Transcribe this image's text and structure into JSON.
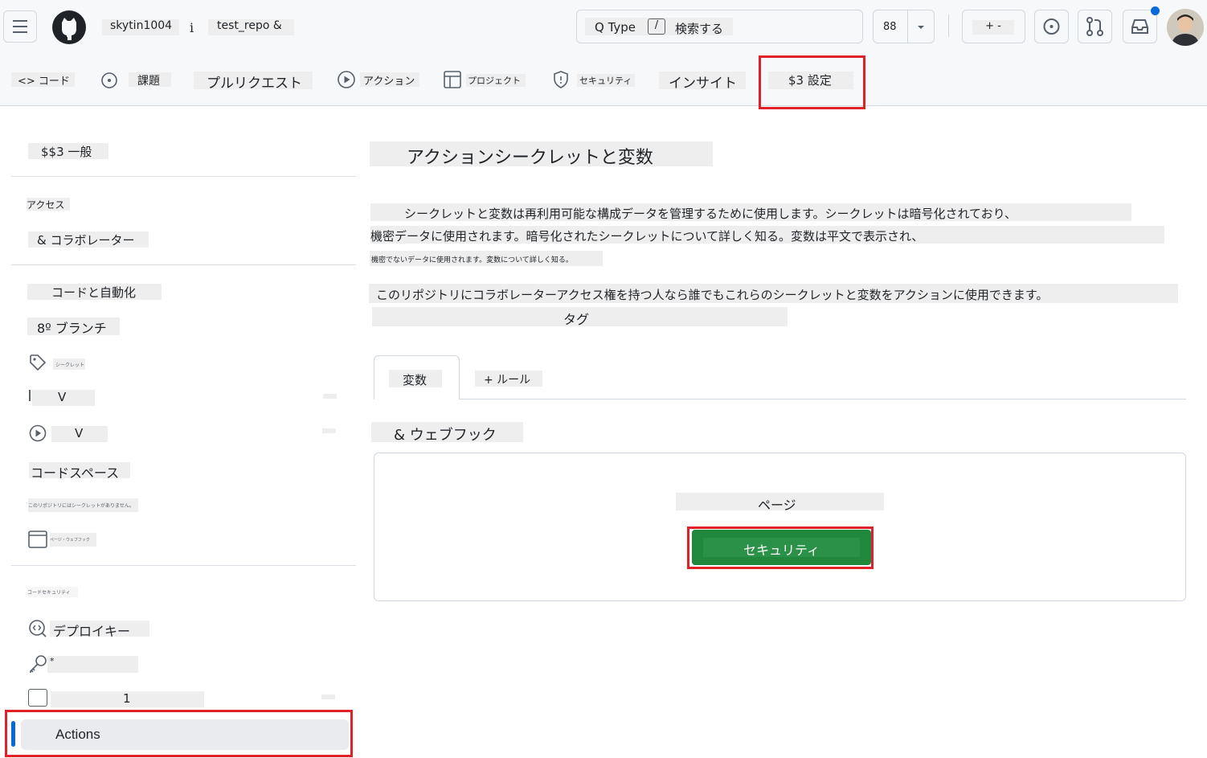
{
  "header": {
    "owner": "skytin1004",
    "separator": "i",
    "repo": "test_repo &",
    "search_prefix": "Q Type",
    "search_key": "/",
    "search_label": "検索する",
    "copilot_label": "88",
    "new_label": "+ -"
  },
  "tabs": [
    {
      "label": "<> コード"
    },
    {
      "label": "課題"
    },
    {
      "label": "プルリクエスト"
    },
    {
      "label": "アクション"
    },
    {
      "label": "プロジェクト"
    },
    {
      "label": "セキュリティ"
    },
    {
      "label": "インサイト"
    },
    {
      "label": "$3 設定"
    }
  ],
  "sidebar": {
    "general": "$$3 一般",
    "access_heading": "アクセス",
    "collaborators": "& コラボレーター",
    "code_heading": "コードと自動化",
    "branches": "8º ブランチ",
    "tags": "シークレット",
    "rules": "V",
    "actions_item": "V",
    "codespaces": "コードスペース",
    "copilot": "このリポジトリにはシークレットがありません。",
    "pages": "ページ・ウェブフック",
    "security_heading": "コードセキュリティ",
    "deploy_keys": "デプロイキー",
    "secrets": "*",
    "environments": "1",
    "actions_selected": "Actions"
  },
  "main": {
    "title": "アクションシークレットと変数",
    "desc_line1": "シークレットと変数は再利用可能な構成データを管理するために使用します。シークレットは暗号化されており、",
    "desc_line2": "機密データに使用されます。暗号化されたシークレットについて詳しく知る。変数は平文で表示され、",
    "desc_line3": "機密でないデータに使用されます。変数について詳しく知る。",
    "desc_access": "このリポジトリにコラボレーターアクセス権を持つ人なら誰でもこれらのシークレットと変数をアクションに使用できます。",
    "tag_label": "タグ",
    "tab_variables": "変数",
    "tab_rules": "+ ルール",
    "section_heading": "& ウェブフック",
    "empty_text": "ページ",
    "button_label": "セキュリティ"
  },
  "colors": {
    "accent_red": "#e0212a",
    "button_green": "#1f883d",
    "notification_blue": "#0969da"
  }
}
